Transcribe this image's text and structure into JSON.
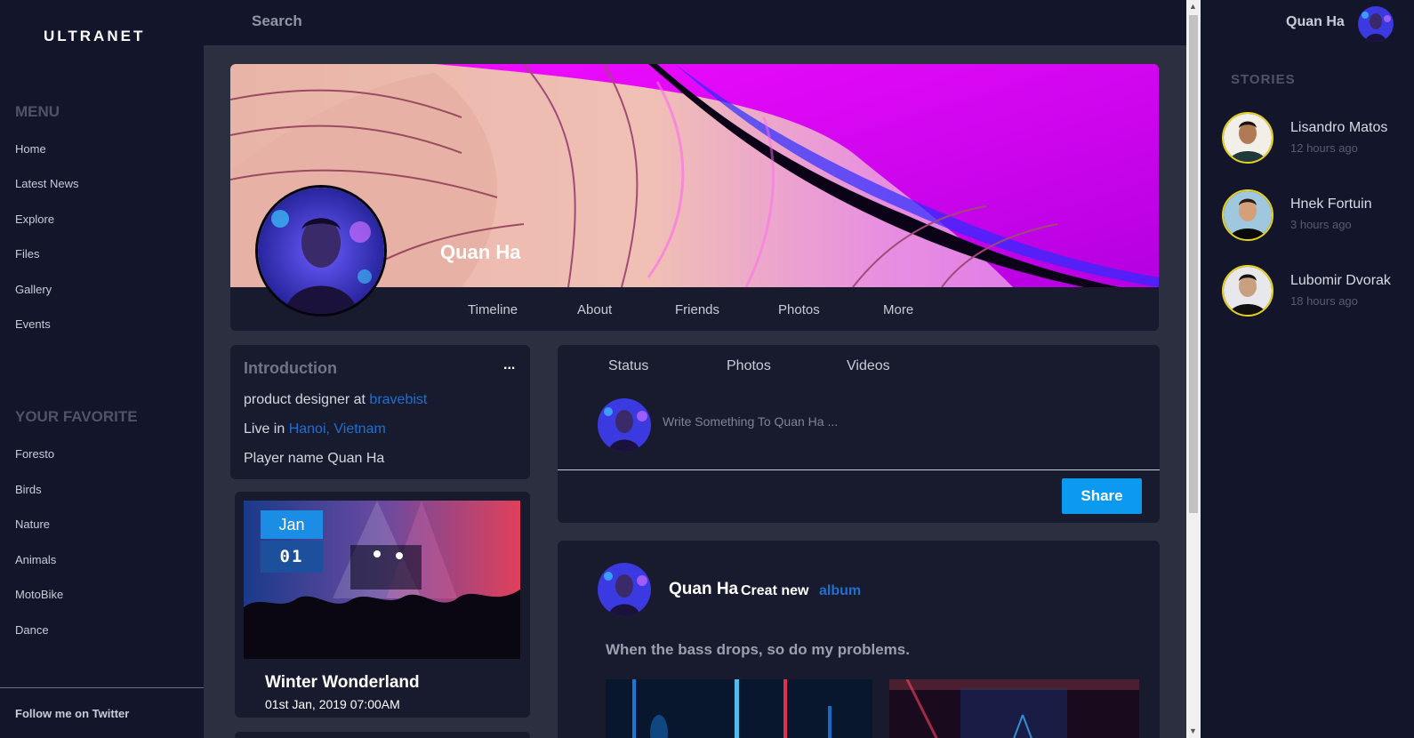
{
  "brand": "ULTRANET",
  "search": {
    "placeholder": "Search"
  },
  "menu": {
    "title": "MENU",
    "items": [
      "Home",
      "Latest News",
      "Explore",
      "Files",
      "Gallery",
      "Events"
    ]
  },
  "favorites": {
    "title": "YOUR FAVORITE",
    "items": [
      "Foresto",
      "Birds",
      "Nature",
      "Animals",
      "MotoBike",
      "Dance"
    ]
  },
  "footer_link": "Follow me on Twitter",
  "user": {
    "name": "Quan Ha"
  },
  "profile": {
    "name": "Quan Ha",
    "tabs": [
      "Timeline",
      "About",
      "Friends",
      "Photos",
      "More"
    ]
  },
  "intro": {
    "title": "Introduction",
    "more": "...",
    "line1_prefix": "product designer at ",
    "line1_link": "bravebist",
    "line2_prefix": "Live in ",
    "line2_link": "Hanoi, Vietnam",
    "line3": "Player name Quan Ha"
  },
  "event": {
    "month": "Jan",
    "day": "01",
    "title": "Winter Wonderland",
    "date": "01st Jan, 2019 07:00AM"
  },
  "composer": {
    "tabs": [
      "Status",
      "Photos",
      "Videos"
    ],
    "placeholder": "Write Something To Quan Ha ...",
    "share_label": "Share"
  },
  "feed_post": {
    "author": "Quan Ha",
    "action": "Creat new",
    "link": "album",
    "text": "When the bass drops, so do my problems."
  },
  "stories": {
    "title": "STORIES",
    "items": [
      {
        "name": "Lisandro Matos",
        "time": "12 hours ago"
      },
      {
        "name": "Hnek Fortuin",
        "time": "3 hours ago"
      },
      {
        "name": "Lubomir Dvorak",
        "time": "18 hours ago"
      }
    ]
  },
  "colors": {
    "background": "#13162b",
    "content_bg": "#2b2f3f",
    "card": "#181b2e",
    "accent": "#0c9af0",
    "link": "#1f6fd0",
    "story_ring": "#e8d21c"
  },
  "icons": [
    "scroll-up-arrow-icon",
    "scroll-down-arrow-icon"
  ]
}
